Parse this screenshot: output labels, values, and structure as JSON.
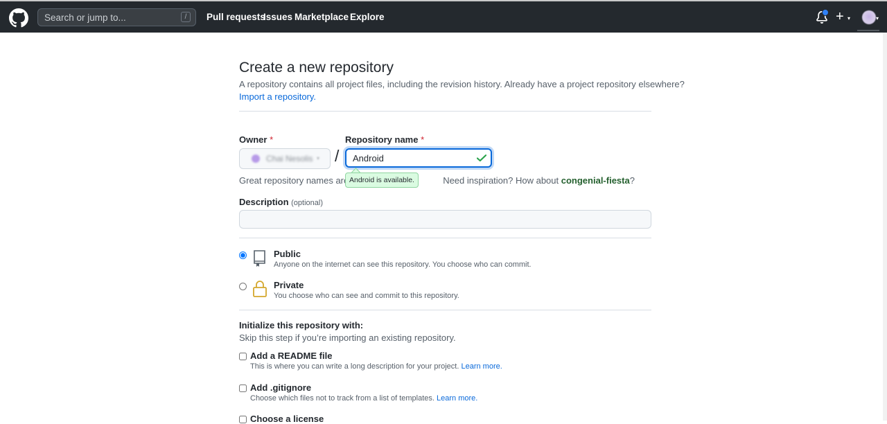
{
  "header": {
    "search_placeholder": "Search or jump to...",
    "search_shortcut": "/",
    "nav": [
      "Pull requests",
      "Issues",
      "Marketplace",
      "Explore"
    ],
    "plus_label": "+",
    "caret": "▾"
  },
  "page": {
    "title": "Create a new repository",
    "subtitle": "A repository contains all project files, including the revision history. Already have a project repository elsewhere?",
    "import_link": "Import a repository."
  },
  "form": {
    "owner_label": "Owner",
    "required_mark": "*",
    "owner_value": "Chai Nesolis",
    "separator": "/",
    "repo_label": "Repository name",
    "repo_value": "Android",
    "availability": "Android is available.",
    "hint_prefix": "Great repository names are sh",
    "hint_suffix": " Need inspiration? How about ",
    "hint_suggestion": "congenial-fiesta",
    "hint_end": "?",
    "description_label": "Description",
    "description_optional": "(optional)",
    "description_value": ""
  },
  "visibility": [
    {
      "title": "Public",
      "desc": "Anyone on the internet can see this repository. You choose who can commit.",
      "checked": true
    },
    {
      "title": "Private",
      "desc": "You choose who can see and commit to this repository.",
      "checked": false
    }
  ],
  "init": {
    "title": "Initialize this repository with:",
    "subtitle": "Skip this step if you’re importing an existing repository.",
    "options": [
      {
        "title": "Add a README file",
        "desc": "This is where you can write a long description for your project.",
        "link": "Learn more."
      },
      {
        "title": "Add .gitignore",
        "desc": "Choose which files not to track from a list of templates.",
        "link": "Learn more."
      },
      {
        "title": "Choose a license"
      }
    ]
  },
  "colors": {
    "header_bg": "#24292e",
    "link": "#0969da",
    "success_bg": "#dafbe1",
    "notification": "#2f81f7"
  }
}
